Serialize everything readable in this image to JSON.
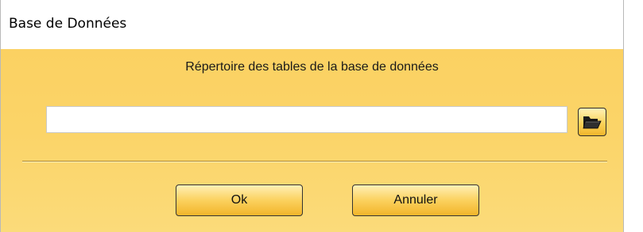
{
  "window": {
    "title": "Base de Données"
  },
  "dialog": {
    "heading": "Répertoire des tables de la base de données",
    "path_value": "",
    "browse_icon": "folder-open-icon",
    "ok_label": "Ok",
    "cancel_label": "Annuler"
  },
  "colors": {
    "background_top": "#fbd162",
    "background_bottom": "#fbdb7a",
    "button_top": "#fff0b6",
    "button_bottom": "#f2b52a"
  }
}
